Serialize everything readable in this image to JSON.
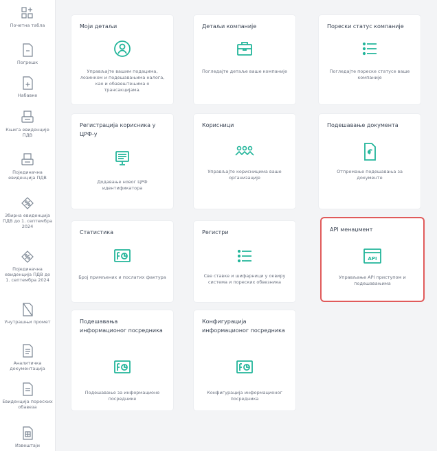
{
  "sidebar": {
    "items": [
      {
        "icon": "grid-plus-icon",
        "label": "Почетна табла"
      },
      {
        "icon": "document-icon",
        "label": "Погрешк"
      },
      {
        "icon": "document-plus-icon",
        "label": "Набавке"
      },
      {
        "icon": "invoice-printer-icon",
        "label": "Књига евиденције ПДВ"
      },
      {
        "icon": "invoice-printer-icon",
        "label": "Појединачна евиденција ПДВ"
      },
      {
        "icon": "percent-tag-icon",
        "label": "Збирна евиденција ПДВ до 1. септембра 2024"
      },
      {
        "icon": "percent-tag-icon",
        "label": "Појединачна евиденција ПДВ до 1. септембра 2024"
      },
      {
        "icon": "document-fold-icon",
        "label": "Унутрашњи промет"
      },
      {
        "icon": "document-lines-icon",
        "label": "Аналитичка документација"
      },
      {
        "icon": "document-list-icon",
        "label": "Евиденција пореских обавеза"
      },
      {
        "icon": "table-document-icon",
        "label": "Извештаји"
      }
    ]
  },
  "cards": [
    {
      "title": "Моји детаљи",
      "icon": "user-circle-icon",
      "description": "Управљајте вашим подацима, лозинком и подешавањима налога, као и обавештењима о трансакцијама."
    },
    {
      "title": "Детаљи компаније",
      "icon": "briefcase-icon",
      "description": "Погледајте детаље ваше компаније"
    },
    {
      "title": "Порески статус компаније",
      "icon": "list-icon",
      "description": "Погледајте пореске статусе ваше компаније"
    },
    {
      "title": "Регистрација корисника у ЦРФ-у",
      "icon": "monitor-icon",
      "description": "Додавање новог ЦРФ идентификатора"
    },
    {
      "title": "Корисници",
      "icon": "users-icon",
      "description": "Управљајте корисницима ваше организације"
    },
    {
      "title": "Подешавање документа",
      "icon": "euro-document-icon",
      "description": "Отпремање подешавања за документе"
    },
    {
      "title": "Статистика",
      "icon": "stats-card-icon",
      "description": "Број примљених и послатих фактура"
    },
    {
      "title": "Регистри",
      "icon": "list-icon",
      "description": "Све ставке и шифарници у оквиру система и пореских обвезника"
    },
    {
      "title": "API менаџмент",
      "icon": "api-icon",
      "description": "Управљање API приступом и подешавањима"
    },
    {
      "title": "Подешавања информационог посредника",
      "icon": "stats-card-icon",
      "description": "Подешавање за информационе посреднике"
    },
    {
      "title": "Конфигурација информационог посредника",
      "icon": "stats-card-icon",
      "description": "Конфигурација информационог посредника"
    }
  ],
  "colors": {
    "accent": "#22b59a",
    "highlight": "#e05a5a",
    "sidebar_icon": "#7a8592"
  }
}
